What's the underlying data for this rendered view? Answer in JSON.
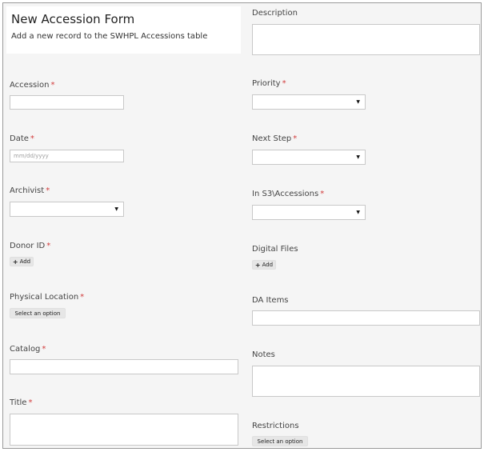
{
  "header": {
    "title": "New Accession Form",
    "subtitle": "Add a new record to the SWHPL Accessions table"
  },
  "left_fields": {
    "accession": {
      "label": "Accession",
      "required": "*",
      "value": ""
    },
    "date": {
      "label": "Date",
      "required": "*",
      "placeholder": "mm/dd/yyyy"
    },
    "archivist": {
      "label": "Archivist",
      "required": "*",
      "selected": ""
    },
    "donor_id": {
      "label": "Donor ID",
      "required": "*",
      "button": "Add"
    },
    "physical_location": {
      "label": "Physical Location",
      "required": "*",
      "button": "Select an option"
    },
    "catalog": {
      "label": "Catalog",
      "required": "*",
      "value": ""
    },
    "title": {
      "label": "Title",
      "required": "*",
      "value": ""
    }
  },
  "right_fields": {
    "description": {
      "label": "Description",
      "value": ""
    },
    "priority": {
      "label": "Priority",
      "required": "*",
      "selected": ""
    },
    "next_step": {
      "label": "Next Step",
      "required": "*",
      "selected": ""
    },
    "in_s3_accessions": {
      "label": "In S3\\Accessions",
      "required": "*",
      "selected": ""
    },
    "digital_files": {
      "label": "Digital Files",
      "button": "Add"
    },
    "da_items": {
      "label": "DA Items",
      "value": ""
    },
    "notes": {
      "label": "Notes",
      "value": ""
    },
    "restrictions": {
      "label": "Restrictions",
      "button": "Select an option"
    }
  },
  "icons": {
    "add": "plus-icon",
    "dropdown": "caret-down-icon"
  },
  "colors": {
    "required_marker": "#d23b3b",
    "background": "#f5f5f5"
  }
}
